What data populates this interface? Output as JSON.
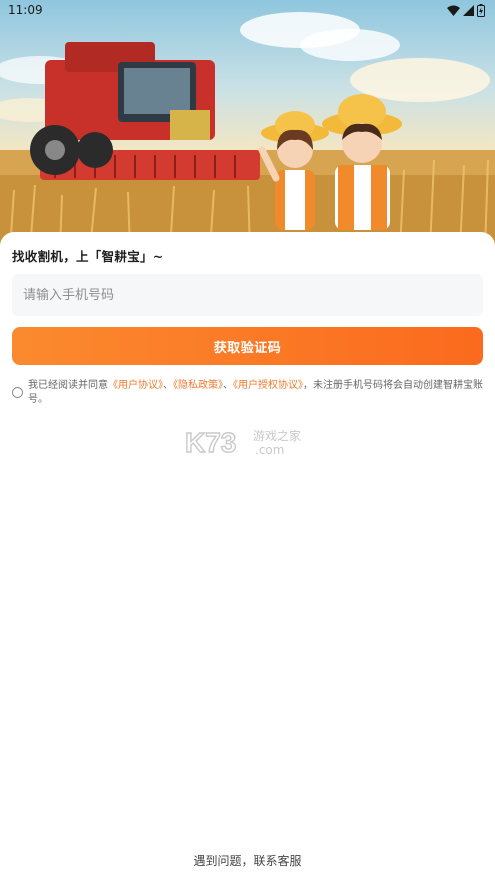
{
  "status_bar": {
    "time": "11:09",
    "icons": [
      "wifi-icon",
      "signal-icon",
      "battery-icon"
    ]
  },
  "hero": {
    "scene": "farm-illustration",
    "accent": "#d9352b"
  },
  "login": {
    "welcome_text": "找收割机，上「智耕宝」~",
    "phone_placeholder": "请输入手机号码",
    "phone_value": "",
    "get_code_label": "获取验证码",
    "agreement": {
      "checked": false,
      "prefix": "我已经阅读并同意",
      "user_agreement": "《用户协议》",
      "sep1": "、",
      "privacy_policy": "《隐私政策》",
      "sep2": "、",
      "authorization_agreement": "《用户授权协议》",
      "suffix": "，未注册手机号码将会自动创建智耕宝账号。"
    },
    "help_text": "遇到问题，联系客服"
  },
  "watermark": {
    "brand": "K73",
    "text1": "游戏之家",
    "text2": ".com"
  },
  "colors": {
    "button_start": "#fb8a2e",
    "button_end": "#fb6a1e",
    "link": "#f07a2c",
    "input_bg": "#f6f7f9"
  }
}
